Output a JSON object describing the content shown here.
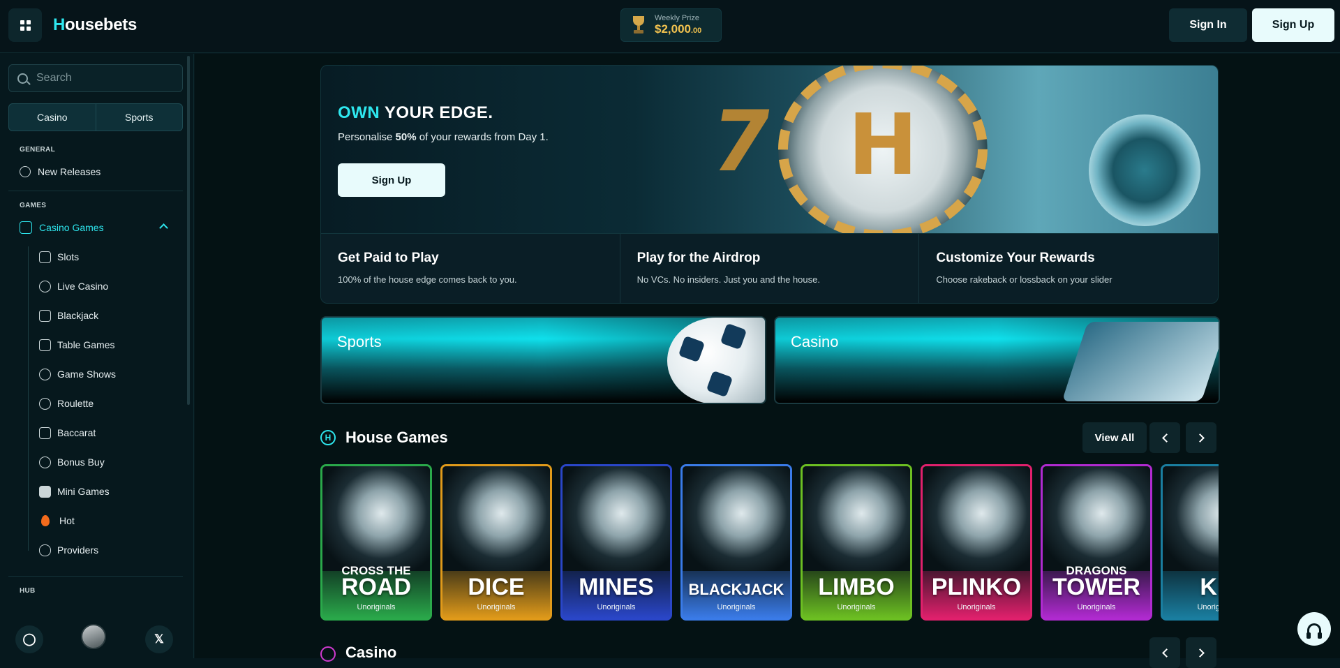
{
  "header": {
    "logo_first": "H",
    "logo_rest": "ousebets",
    "prize_label": "Weekly Prize",
    "prize_amount": "$2,000",
    "prize_cents": ".00",
    "sign_in": "Sign In",
    "sign_up": "Sign Up"
  },
  "sidebar": {
    "search_placeholder": "Search",
    "tabs": [
      "Casino",
      "Sports"
    ],
    "general_label": "GENERAL",
    "new_releases": "New Releases",
    "games_label": "GAMES",
    "casino_games": "Casino Games",
    "sub_items": [
      "Slots",
      "Live Casino",
      "Blackjack",
      "Table Games",
      "Game Shows",
      "Roulette",
      "Baccarat",
      "Bonus Buy",
      "Mini Games",
      "Hot",
      "Providers"
    ],
    "hub_label": "HUB"
  },
  "hero": {
    "title_accent": "OWN",
    "title_rest": " YOUR EDGE.",
    "sub_pre": "Personalise ",
    "sub_bold": "50%",
    "sub_post": " of your rewards from Day 1.",
    "button": "Sign Up"
  },
  "features": [
    {
      "title": "Get Paid to Play",
      "desc": "100% of the house edge comes back to you."
    },
    {
      "title": "Play for the Airdrop",
      "desc": "No VCs. No insiders. Just you and the house."
    },
    {
      "title": "Customize Your Rewards",
      "desc": "Choose rakeback or lossback on your slider"
    }
  ],
  "categories": [
    "Sports",
    "Casino"
  ],
  "house_games": {
    "badge": "H",
    "title": "House Games",
    "view_all": "View All",
    "items": [
      {
        "pre": "CROSS THE",
        "name": "ROAD",
        "sub": "Unoriginals",
        "color": "#2aa84a"
      },
      {
        "pre": "",
        "name": "DICE",
        "sub": "Unoriginals",
        "color": "#e09a1a"
      },
      {
        "pre": "",
        "name": "MINES",
        "sub": "Unoriginals",
        "color": "#2a46c8"
      },
      {
        "pre": "",
        "name": "BLACKJACK",
        "sub": "Unoriginals",
        "color": "#3a7be8"
      },
      {
        "pre": "",
        "name": "LIMBO",
        "sub": "Unoriginals",
        "color": "#6cbf22"
      },
      {
        "pre": "",
        "name": "PLINKO",
        "sub": "Unoriginals",
        "color": "#e0206c"
      },
      {
        "pre": "DRAGONS",
        "name": "TOWER",
        "sub": "Unoriginals",
        "color": "#b02ad0"
      },
      {
        "pre": "",
        "name": "KE",
        "sub": "Unoriginals",
        "color": "#1a7ea0"
      }
    ]
  },
  "casino_section": {
    "title": "Casino"
  },
  "colors": {
    "accent": "#2ee6ee",
    "background": "#06181d",
    "prize": "#f2c24f"
  }
}
